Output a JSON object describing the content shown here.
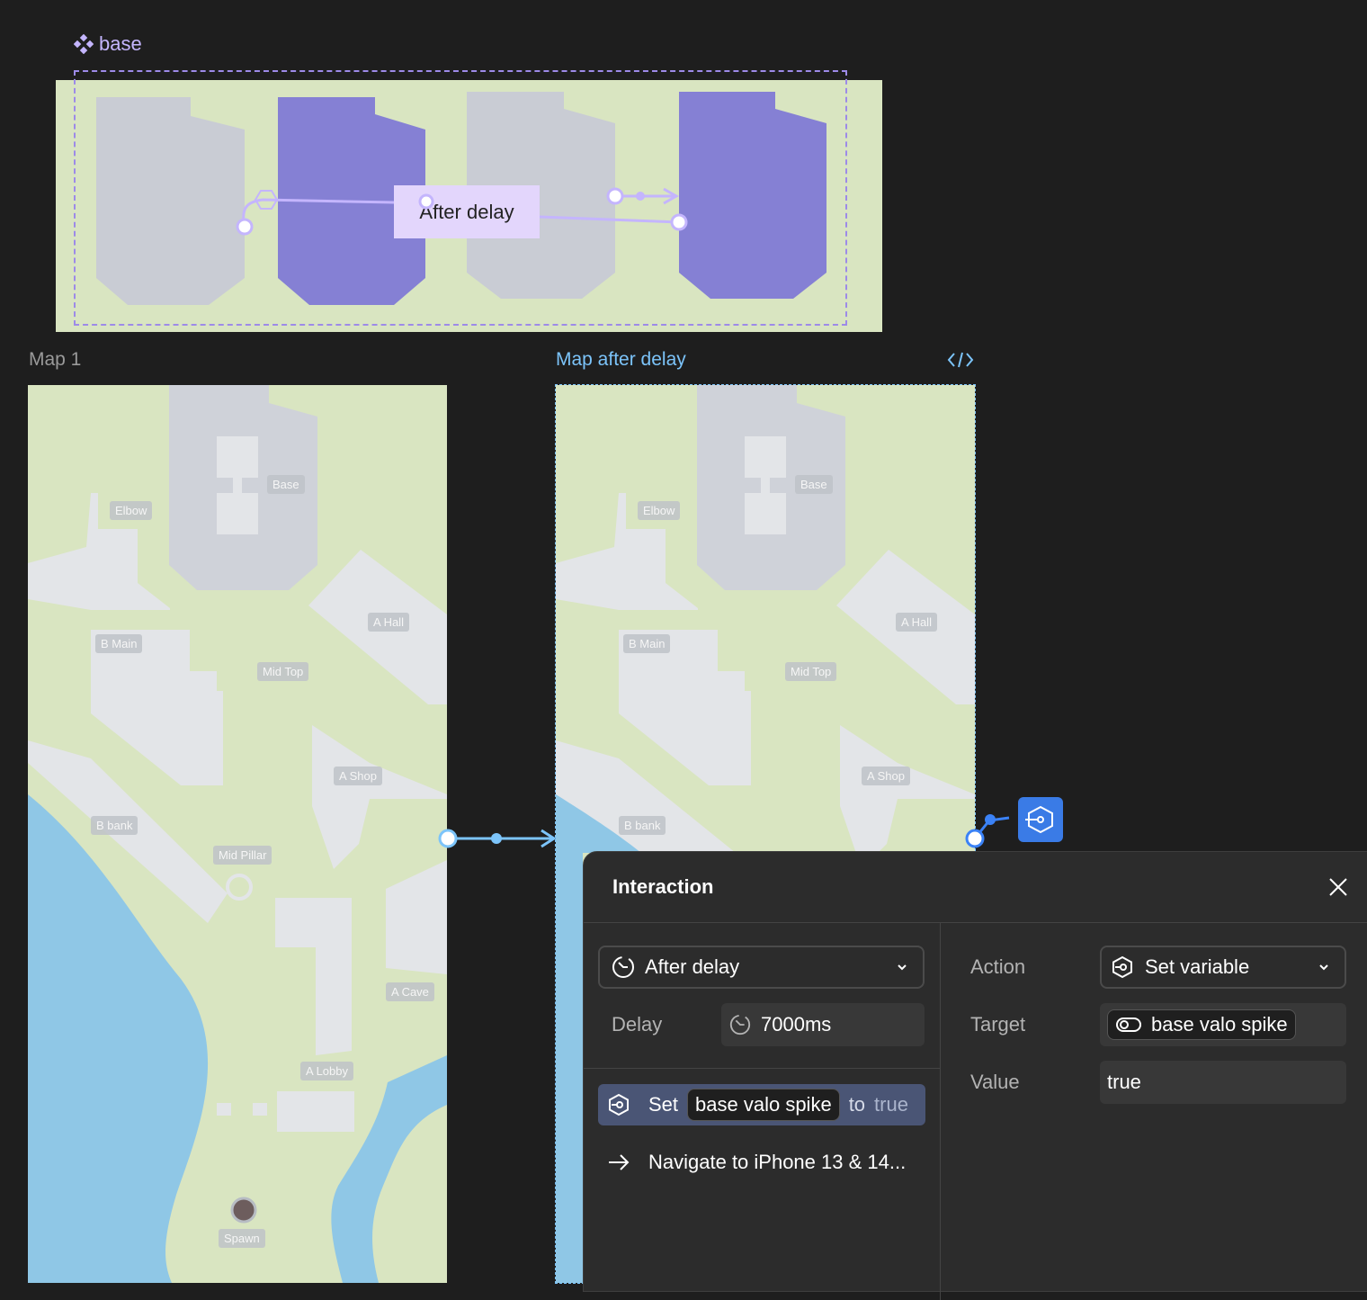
{
  "component": {
    "name": "base",
    "trigger_chip": "After delay"
  },
  "frames": [
    {
      "title": "Map 1",
      "title_color": "#9a9a9a"
    },
    {
      "title": "Map after delay",
      "title_color": "#7cc4fa"
    }
  ],
  "map_labels": [
    "Base",
    "Elbow",
    "A Hall",
    "B Main",
    "Mid Top",
    "A Shop",
    "B bank",
    "Mid Pillar",
    "A Cave",
    "A Lobby",
    "Spawn"
  ],
  "panel": {
    "title": "Interaction",
    "trigger": {
      "label": "After delay",
      "icon": "timer-icon"
    },
    "delay": {
      "label": "Delay",
      "value": "7000ms"
    },
    "actions": [
      {
        "verb": "Set",
        "variable": "base valo spike",
        "connector": "to",
        "value": "true",
        "icon": "set-variable-icon",
        "selected": true
      },
      {
        "text": "Navigate to iPhone 13 & 14...",
        "icon": "arrow-right-icon",
        "selected": false
      }
    ],
    "action_field": {
      "label": "Action",
      "value": "Set variable"
    },
    "target_field": {
      "label": "Target",
      "value": "base valo spike"
    },
    "value_field": {
      "label": "Value",
      "value": "true"
    }
  },
  "colors": {
    "grass": "#d9e5c1",
    "building": "#e3e5e8",
    "water": "#8fc7e6",
    "accent_purple": "#8b80d6",
    "connection_blue": "#7cc4fa",
    "action_blue": "#3b82f6"
  }
}
